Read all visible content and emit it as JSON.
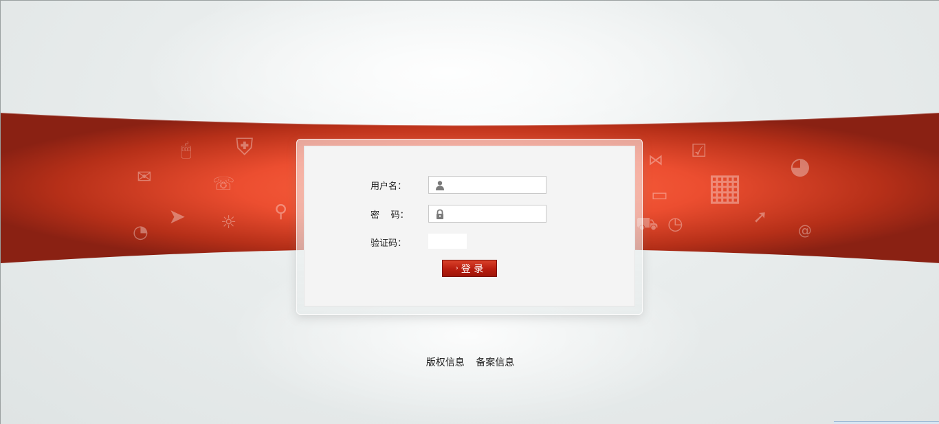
{
  "login": {
    "username_label": "用户名：",
    "password_label": "密    码：",
    "captcha_label": "验证码：",
    "username_value": "",
    "password_value": "",
    "captcha_value": "",
    "submit_label": "登 录",
    "user_icon": "user-icon",
    "lock_icon": "lock-icon"
  },
  "footer": {
    "copyright_link": "版权信息",
    "icp_link": "备案信息"
  },
  "theme": {
    "accent": "#e8492f",
    "band_dark": "#8e2214",
    "button": "#c32713"
  }
}
